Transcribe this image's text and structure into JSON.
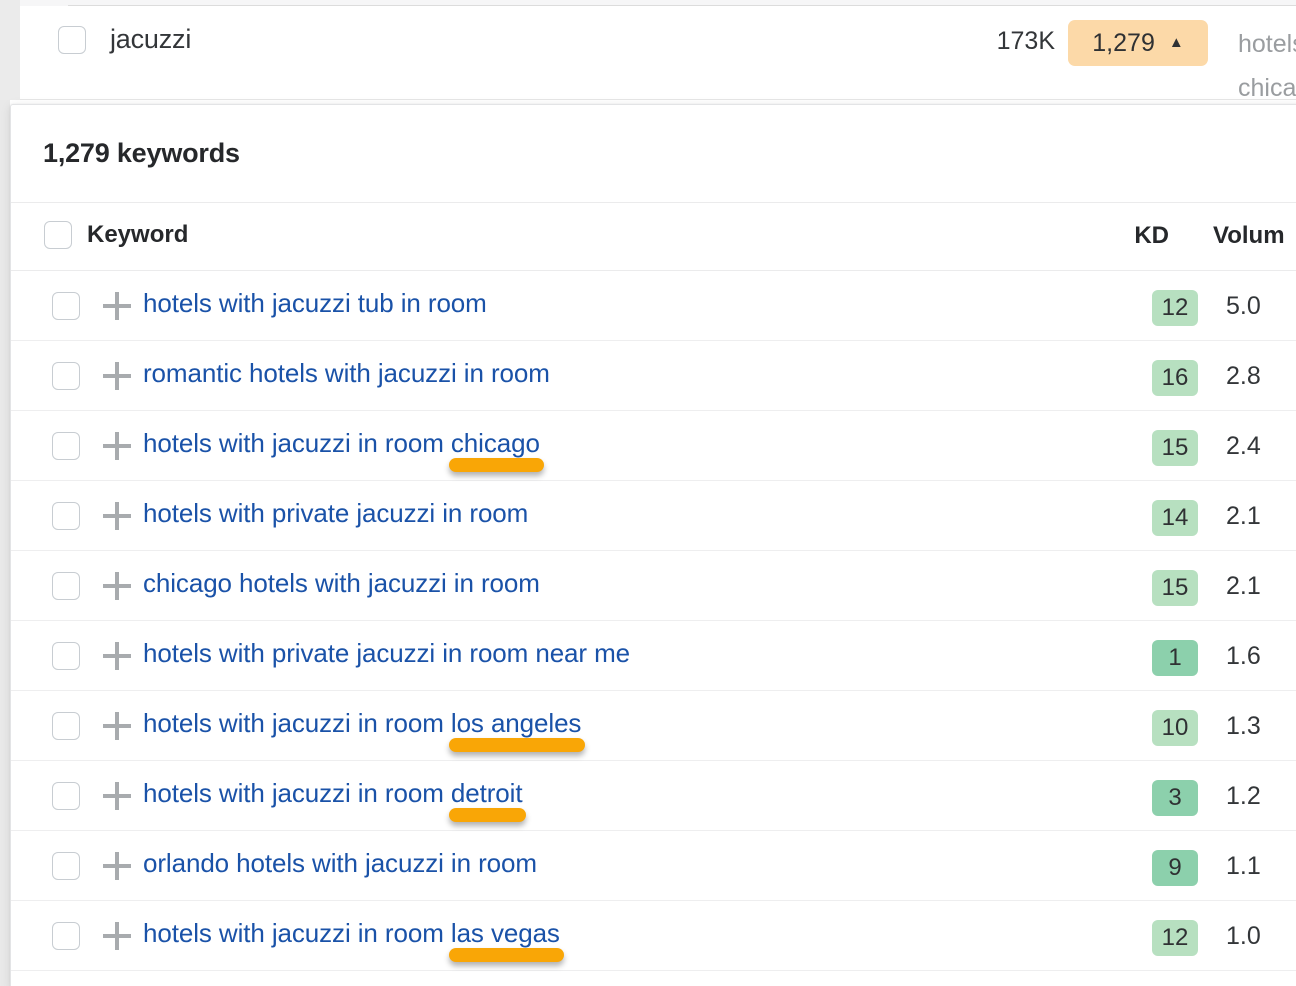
{
  "top_row": {
    "keyword": "jacuzzi",
    "volume": "173K",
    "keyword_count_badge": "1,279",
    "badge_caret": "▲",
    "truncated_line1": "hotels",
    "truncated_line2": "chicag",
    "badge_color": "#fcd9a8"
  },
  "panel": {
    "title": "1,279 keywords",
    "columns": {
      "keyword": "Keyword",
      "kd": "KD",
      "volume": "Volum"
    },
    "link_color": "#1a52a8",
    "highlight_color": "#f9a606",
    "kd_light_color": "#b7e0c0",
    "kd_mid_color": "#8cd0ac",
    "rows": [
      {
        "keyword_prefix": "hotels with jacuzzi tub in room",
        "keyword_highlight": "",
        "kd": "12",
        "kd_shade": "light",
        "volume": "5.0"
      },
      {
        "keyword_prefix": "romantic hotels with jacuzzi in room",
        "keyword_highlight": "",
        "kd": "16",
        "kd_shade": "light",
        "volume": "2.8"
      },
      {
        "keyword_prefix": "hotels with jacuzzi in room ",
        "keyword_highlight": "chicago",
        "kd": "15",
        "kd_shade": "light",
        "volume": "2.4"
      },
      {
        "keyword_prefix": "hotels with private jacuzzi in room",
        "keyword_highlight": "",
        "kd": "14",
        "kd_shade": "light",
        "volume": "2.1"
      },
      {
        "keyword_prefix": "chicago hotels with jacuzzi in room",
        "keyword_highlight": "",
        "kd": "15",
        "kd_shade": "light",
        "volume": "2.1"
      },
      {
        "keyword_prefix": "hotels with private jacuzzi in room near me",
        "keyword_highlight": "",
        "kd": "1",
        "kd_shade": "mid",
        "volume": "1.6"
      },
      {
        "keyword_prefix": "hotels with jacuzzi in room ",
        "keyword_highlight": "los angeles",
        "kd": "10",
        "kd_shade": "light",
        "volume": "1.3"
      },
      {
        "keyword_prefix": "hotels with jacuzzi in room ",
        "keyword_highlight": "detroit",
        "kd": "3",
        "kd_shade": "mid",
        "volume": "1.2"
      },
      {
        "keyword_prefix": "orlando hotels with jacuzzi in room",
        "keyword_highlight": "",
        "kd": "9",
        "kd_shade": "mid",
        "volume": "1.1"
      },
      {
        "keyword_prefix": "hotels with jacuzzi in room ",
        "keyword_highlight": "las vegas",
        "kd": "12",
        "kd_shade": "light",
        "volume": "1.0"
      }
    ]
  }
}
